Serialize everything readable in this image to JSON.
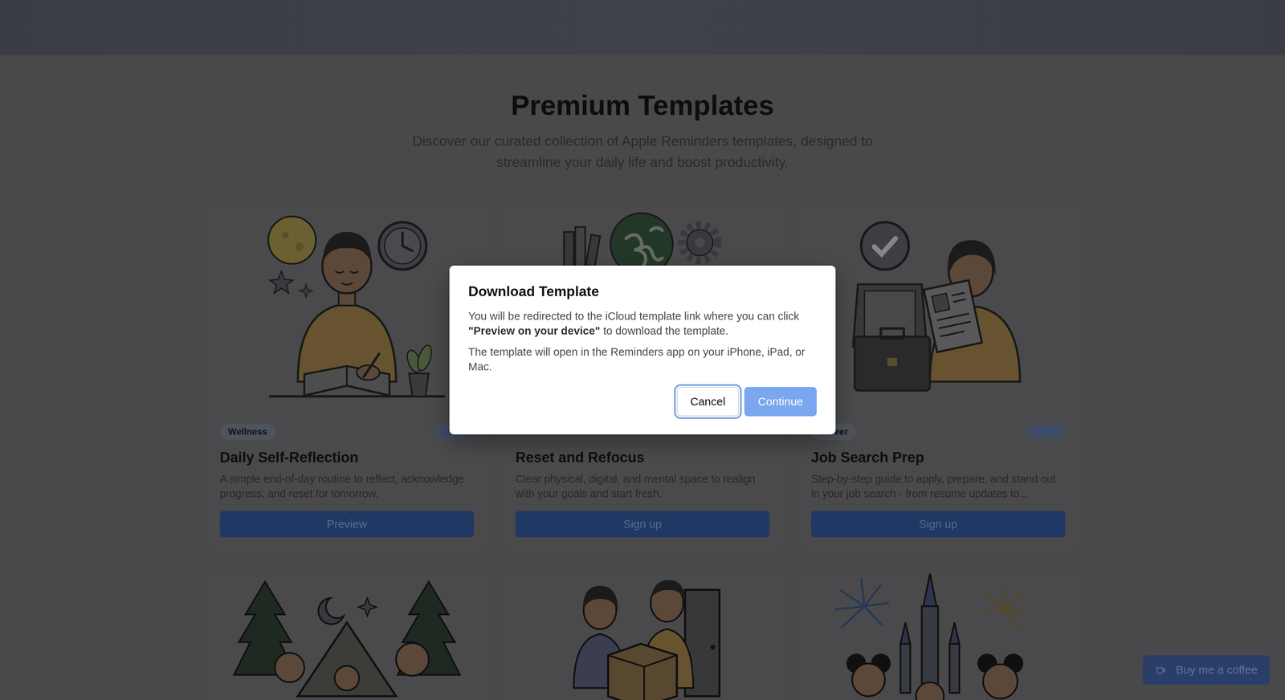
{
  "page": {
    "title": "Premium Templates",
    "subtitle": "Discover our curated collection of Apple Reminders templates, designed to streamline your daily life and boost productivity."
  },
  "cards": [
    {
      "category": "Wellness",
      "price": "FREE",
      "title": "Daily Self-Reflection",
      "description": "A simple end-of-day routine to reflect, acknowledge progress, and reset for tomorrow.",
      "button": "Preview"
    },
    {
      "title": "Reset and Refocus",
      "description": "Clear physical, digital, and mental space to realign with your goals and start fresh.",
      "button": "Sign up"
    },
    {
      "category": "Career",
      "price": "FREE",
      "title": "Job Search Prep",
      "description": "Step-by-step guide to apply, prepare, and stand out in your job search - from resume updates to...",
      "button": "Sign up"
    }
  ],
  "dialog": {
    "title": "Download Template",
    "paragraphs": [
      [
        {
          "text": "You will be redirected to the iCloud template link where you can click ",
          "bold": false
        },
        {
          "text": "\"Preview on your device\"",
          "bold": true
        },
        {
          "text": " to download the template.",
          "bold": false
        }
      ],
      [
        {
          "text": "The template will open in the Reminders app on your iPhone, iPad, or Mac.",
          "bold": false
        }
      ]
    ],
    "buttons": [
      {
        "label": "Cancel",
        "kind": "secondary",
        "focused": true
      },
      {
        "label": "Continue",
        "kind": "primary",
        "focused": false
      }
    ]
  },
  "floating_button": {
    "label": "Buy me a coffee"
  }
}
